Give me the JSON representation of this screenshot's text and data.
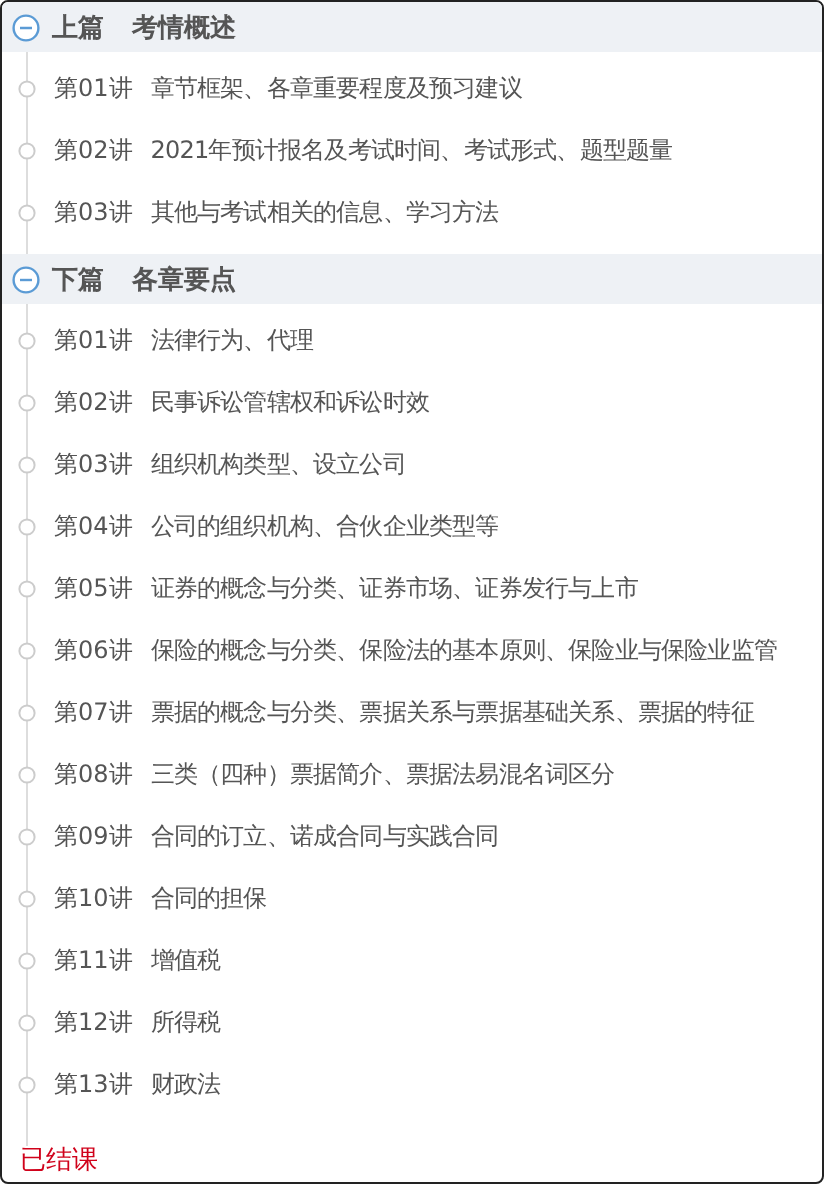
{
  "sections": [
    {
      "part": "上篇",
      "title": "考情概述",
      "expanded": true,
      "lessons": [
        {
          "number": "第01讲",
          "title": "章节框架、各章重要程度及预习建议"
        },
        {
          "number": "第02讲",
          "title": "2021年预计报名及考试时间、考试形式、题型题量"
        },
        {
          "number": "第03讲",
          "title": "其他与考试相关的信息、学习方法"
        }
      ]
    },
    {
      "part": "下篇",
      "title": "各章要点",
      "expanded": true,
      "lessons": [
        {
          "number": "第01讲",
          "title": "法律行为、代理"
        },
        {
          "number": "第02讲",
          "title": "民事诉讼管辖权和诉讼时效"
        },
        {
          "number": "第03讲",
          "title": "组织机构类型、设立公司"
        },
        {
          "number": "第04讲",
          "title": "公司的组织机构、合伙企业类型等"
        },
        {
          "number": "第05讲",
          "title": "证券的概念与分类、证券市场、证券发行与上市"
        },
        {
          "number": "第06讲",
          "title": "保险的概念与分类、保险法的基本原则、保险业与保险业监管"
        },
        {
          "number": "第07讲",
          "title": "票据的概念与分类、票据关系与票据基础关系、票据的特征"
        },
        {
          "number": "第08讲",
          "title": "三类（四种）票据简介、票据法易混名词区分"
        },
        {
          "number": "第09讲",
          "title": "合同的订立、诺成合同与实践合同"
        },
        {
          "number": "第10讲",
          "title": "合同的担保"
        },
        {
          "number": "第11讲",
          "title": "增值税"
        },
        {
          "number": "第12讲",
          "title": "所得税"
        },
        {
          "number": "第13讲",
          "title": "财政法"
        }
      ]
    }
  ],
  "footer_status": "已结课"
}
